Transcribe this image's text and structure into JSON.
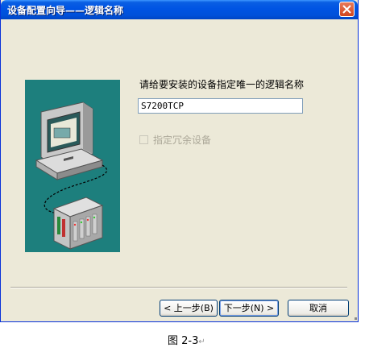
{
  "window": {
    "title": "设备配置向导——逻辑名称"
  },
  "main": {
    "prompt": "请给要安装的设备指定唯一的逻辑名称",
    "name_value": "S7200TCP",
    "redundant_label": "指定冗余设备",
    "redundant_checked": false,
    "redundant_enabled": false
  },
  "buttons": {
    "back_label": "< 上一步(B)",
    "next_label": "下一步(N) >",
    "cancel_label": "取消"
  },
  "caption": {
    "text": "图 2-3",
    "mark": "↵"
  },
  "colors": {
    "title_bar": "#0054e3",
    "picture_bg": "#1d7f7d",
    "dialog_bg": "#ece9d8"
  },
  "icons": {
    "close": "close-icon",
    "computer": "computer-illustration-icon",
    "plc": "plc-rack-icon"
  }
}
